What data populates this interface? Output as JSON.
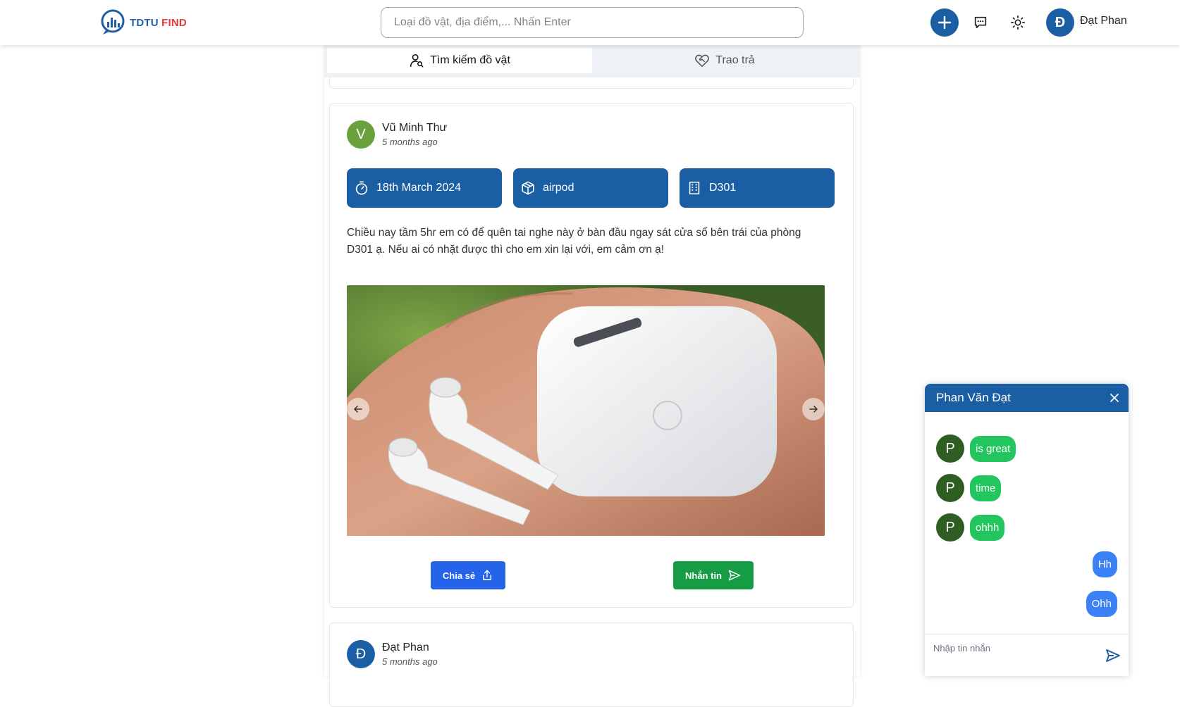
{
  "header": {
    "logo_text_a": "TDTU",
    "logo_text_b": "FIND",
    "search_placeholder": "Loại đồ vật, địa điểm,... Nhấn Enter",
    "user_initial": "Đ",
    "user_name": "Đạt Phan"
  },
  "tabs": [
    {
      "label": "Tìm kiếm đồ vật",
      "active": true
    },
    {
      "label": "Trao trả",
      "active": false
    }
  ],
  "posts": [
    {
      "author_initial": "V",
      "author_name": "Vũ Minh Thư",
      "time": "5 months ago",
      "avatar_color": "#6aa13f",
      "chips": [
        {
          "icon": "timer-icon",
          "label": "18th March 2024"
        },
        {
          "icon": "package-icon",
          "label": "airpod"
        },
        {
          "icon": "building-icon",
          "label": "D301"
        }
      ],
      "description": "Chiều nay tầm 5hr em có để quên tai nghe này ở bàn đầu ngay sát cửa sổ bên trái của phòng D301 ạ. Nếu ai có nhặt được thì cho em xin lại với, em cảm ơn ạ!",
      "share_label": "Chia sẻ",
      "message_label": "Nhắn tin"
    },
    {
      "author_initial": "Đ",
      "author_name": "Đạt Phan",
      "time": "5 months ago",
      "avatar_color": "#1a5fa3"
    }
  ],
  "chat": {
    "title": "Phan Văn Đạt",
    "incoming": [
      {
        "initial": "P",
        "text": "is great"
      },
      {
        "initial": "P",
        "text": "time"
      },
      {
        "initial": "P",
        "text": "ohhh"
      }
    ],
    "outgoing": [
      {
        "text": "Hh"
      },
      {
        "text": "Ohh"
      }
    ],
    "input_placeholder": "Nhập tin nhắn"
  },
  "colors": {
    "primary": "#1a5fa3",
    "share_button": "#2563eb",
    "message_button": "#169c45",
    "bubble_in": "#22c55e",
    "bubble_out": "#3b82f6"
  }
}
